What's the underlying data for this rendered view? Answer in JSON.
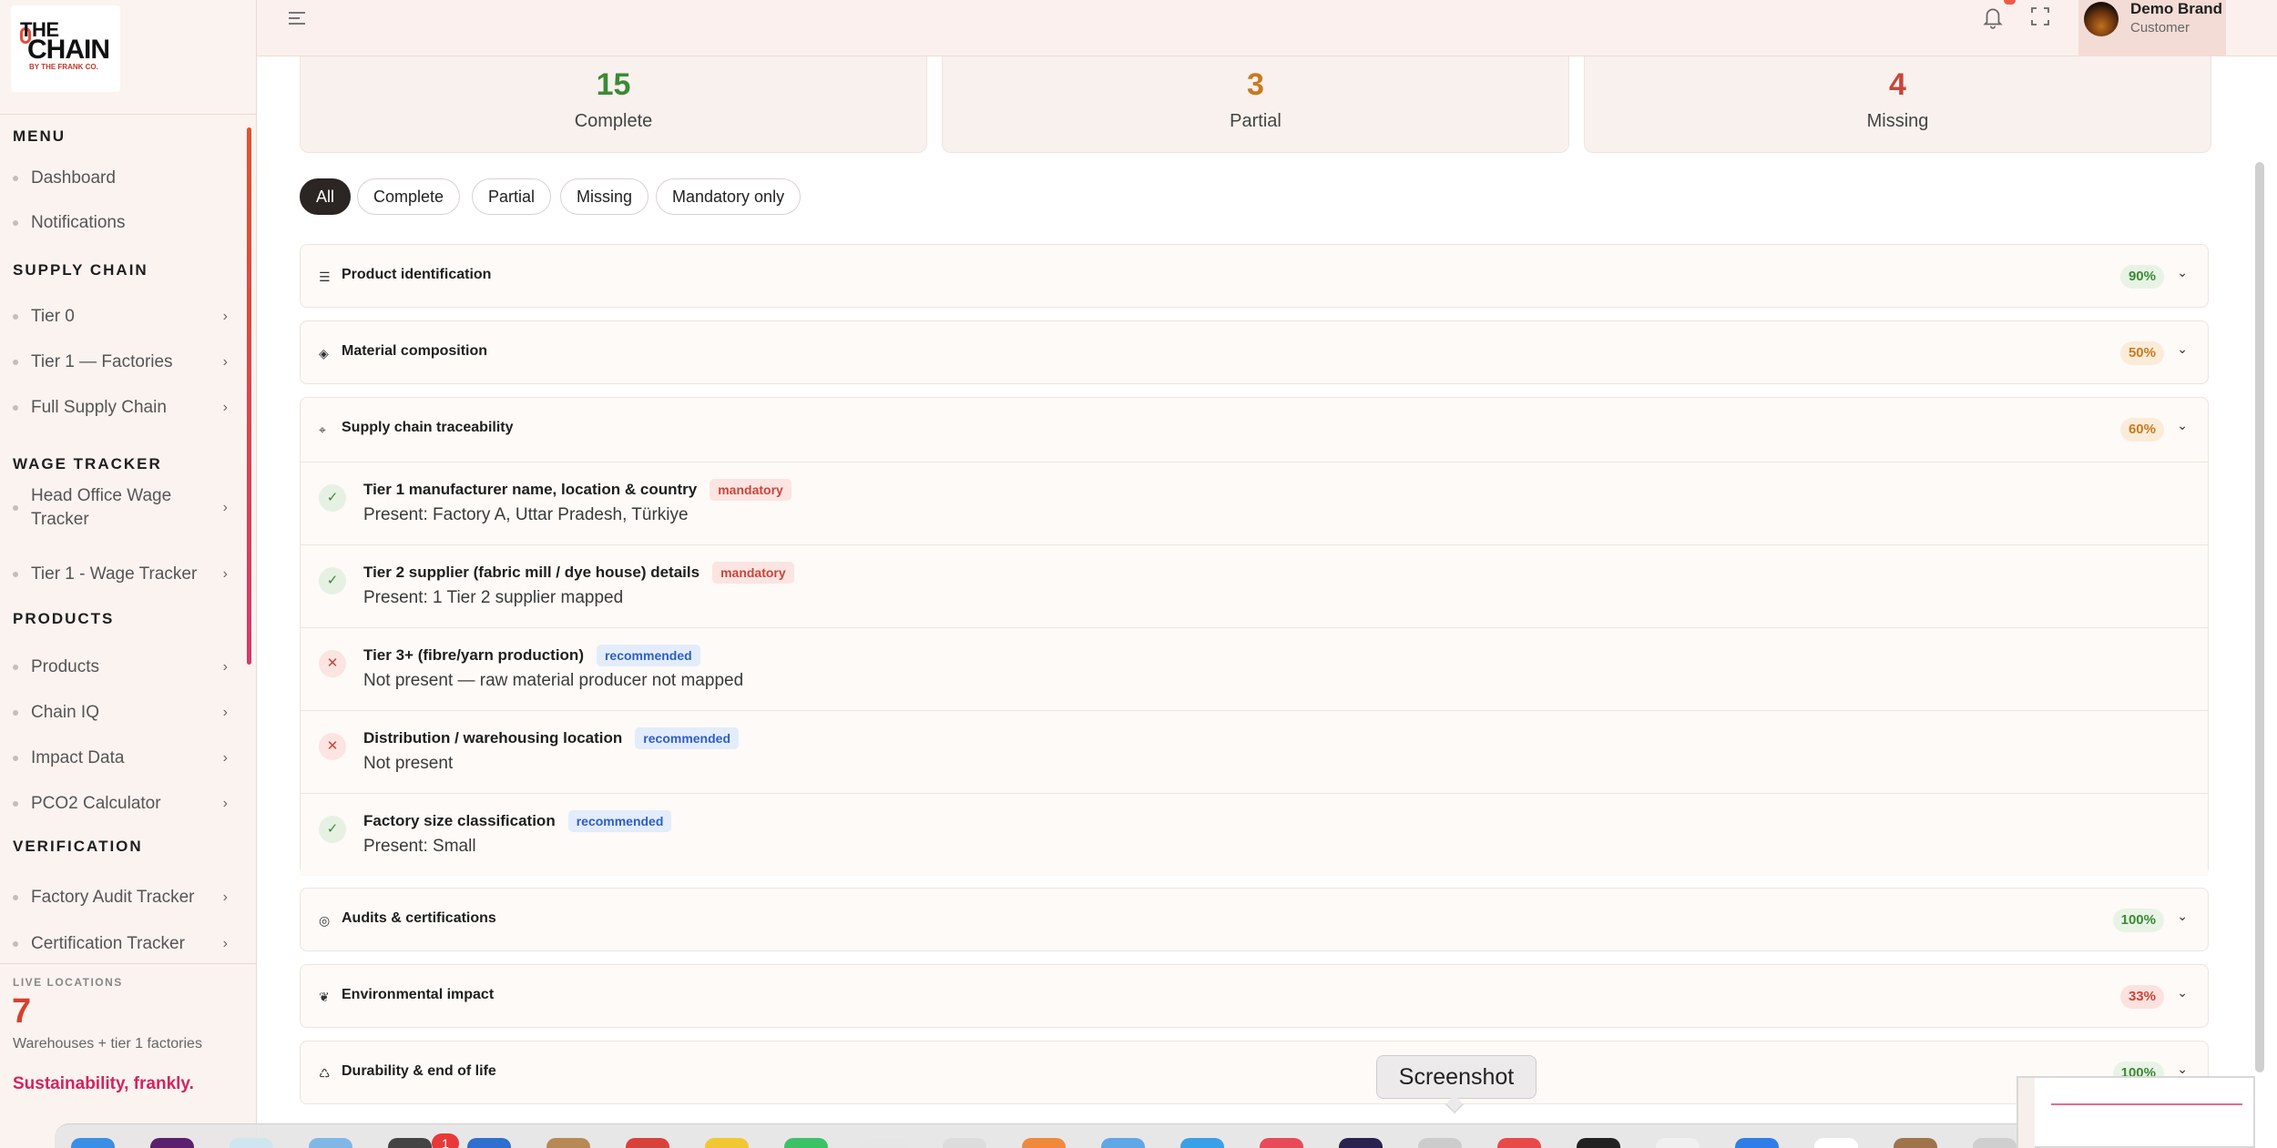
{
  "brand": {
    "logo_top": "THE",
    "logo_main": "CHAIN",
    "logo_sub": "BY THE FRANK CO."
  },
  "sidebar": {
    "sections": [
      {
        "title": "MENU",
        "items": [
          {
            "label": "Dashboard",
            "has_chevron": false
          },
          {
            "label": "Notifications",
            "has_chevron": false
          }
        ]
      },
      {
        "title": "SUPPLY CHAIN",
        "items": [
          {
            "label": "Tier 0",
            "has_chevron": true
          },
          {
            "label": "Tier 1 — Factories",
            "has_chevron": true
          },
          {
            "label": "Full Supply Chain",
            "has_chevron": true
          }
        ]
      },
      {
        "title": "WAGE TRACKER",
        "items": [
          {
            "label": "Head Office Wage Tracker",
            "has_chevron": true
          },
          {
            "label": "Tier 1 - Wage Tracker",
            "has_chevron": true
          }
        ]
      },
      {
        "title": "PRODUCTS",
        "items": [
          {
            "label": "Products",
            "has_chevron": true
          },
          {
            "label": "Chain IQ",
            "has_chevron": true
          },
          {
            "label": "Impact Data",
            "has_chevron": true
          },
          {
            "label": "PCO2 Calculator",
            "has_chevron": true
          }
        ]
      },
      {
        "title": "VERIFICATION",
        "items": [
          {
            "label": "Factory Audit Tracker",
            "has_chevron": true
          },
          {
            "label": "Certification Tracker",
            "has_chevron": true
          }
        ]
      }
    ],
    "chevron": "›",
    "live_locations_label": "LIVE LOCATIONS",
    "live_locations_count": "7",
    "live_locations_desc": "Warehouses + tier 1 factories",
    "tagline": "Sustainability, frankly."
  },
  "topbar": {
    "user_name": "Demo Brand",
    "user_role": "Customer",
    "icons": [
      "menu-icon",
      "bell-icon",
      "expand-icon"
    ]
  },
  "stats": [
    {
      "value": "15",
      "label": "Complete",
      "color": "#3c8a35"
    },
    {
      "value": "3",
      "label": "Partial",
      "color": "#c97a1e"
    },
    {
      "value": "4",
      "label": "Missing",
      "color": "#c9453a"
    }
  ],
  "filters": [
    "All",
    "Complete",
    "Partial",
    "Missing",
    "Mandatory only"
  ],
  "active_filter": "All",
  "sections": [
    {
      "name": "Product identification",
      "icon": "☰",
      "pct": "90%",
      "level": "green",
      "expanded": false
    },
    {
      "name": "Material composition",
      "icon": "◈",
      "pct": "50%",
      "level": "orange",
      "expanded": false
    },
    {
      "name": "Supply chain traceability",
      "icon": "⌖",
      "pct": "60%",
      "level": "orange",
      "expanded": true,
      "items": [
        {
          "status": "ok",
          "title": "Tier 1 manufacturer name, location & country",
          "tag": "mandatory",
          "desc": "Present: Factory A, Uttar Pradesh, Türkiye"
        },
        {
          "status": "ok",
          "title": "Tier 2 supplier (fabric mill / dye house) details",
          "tag": "mandatory",
          "desc": "Present: 1 Tier 2 supplier mapped"
        },
        {
          "status": "no",
          "title": "Tier 3+ (fibre/yarn production)",
          "tag": "recommended",
          "desc": "Not present — raw material producer not mapped"
        },
        {
          "status": "no",
          "title": "Distribution / warehousing location",
          "tag": "recommended",
          "desc": "Not present"
        },
        {
          "status": "ok",
          "title": "Factory size classification",
          "tag": "recommended",
          "desc": "Present: Small"
        }
      ]
    },
    {
      "name": "Audits & certifications",
      "icon": "◎",
      "pct": "100%",
      "level": "green",
      "expanded": false
    },
    {
      "name": "Environmental impact",
      "icon": "❦",
      "pct": "33%",
      "level": "red",
      "expanded": false
    },
    {
      "name": "Durability & end of life",
      "icon": "♺",
      "pct": "100%",
      "level": "green",
      "expanded": false
    }
  ],
  "tooltip": "Screenshot",
  "dock_badge": "1"
}
